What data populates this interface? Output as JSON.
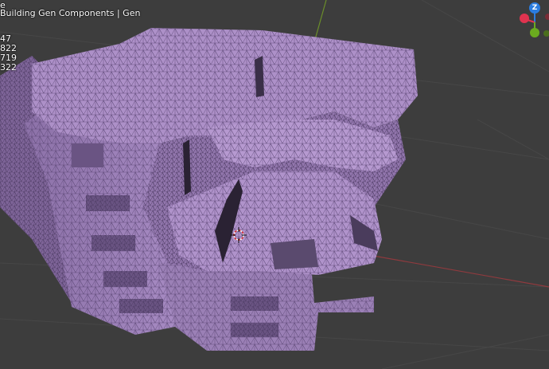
{
  "viewport": {
    "mode_text": "e",
    "collection_text": "Building Gen Components | Gen",
    "stats": [
      "47",
      "822",
      "719",
      "322"
    ]
  },
  "gizmo": {
    "z_label": "Z",
    "axis_colors": {
      "x": "#e0334f",
      "y": "#6bab1f",
      "z": "#2b7de0"
    }
  },
  "colors": {
    "background": "#3d3d3d",
    "grid": "#4a4a4a",
    "x_axis": "#9b3a3f",
    "y_axis": "#6b8e2a",
    "mesh": "#a98ac4",
    "wire": "#5b4674"
  },
  "objects": {
    "mesh_name": "ruined-building-mesh",
    "cursor": "3d-cursor-icon"
  }
}
